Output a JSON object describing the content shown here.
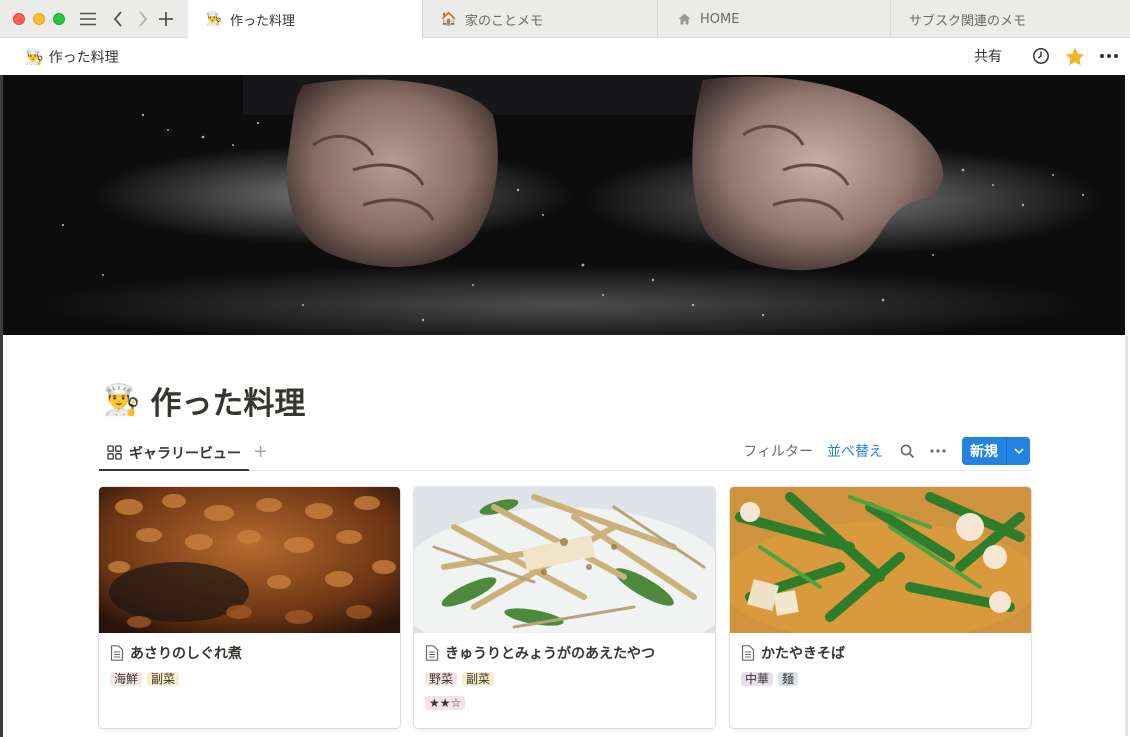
{
  "tabs": [
    {
      "label": "作った料理",
      "icon": "cook-emoji",
      "emoji": "👨‍🍳"
    },
    {
      "label": "家のことメモ",
      "icon": "house-emoji",
      "emoji": "🏠"
    },
    {
      "label": "HOME",
      "icon": "home-icon",
      "emoji": "⌂"
    },
    {
      "label": "サブスク関連のメモ",
      "icon": "",
      "emoji": ""
    }
  ],
  "breadcrumb": {
    "emoji": "👨‍🍳",
    "label": "作った料理"
  },
  "topbar": {
    "share_label": "共有"
  },
  "page": {
    "emoji": "👨‍🍳",
    "title": "作った料理"
  },
  "view": {
    "tab_label": "ギャラリービュー",
    "add_symbol": "+",
    "filter_label": "フィルター",
    "sort_label": "並べ替え",
    "new_label": "新規"
  },
  "cards": [
    {
      "title": "あさりのしぐれ煮",
      "tags": [
        {
          "label": "海鮮",
          "color": "#fbe4e4"
        },
        {
          "label": "副菜",
          "color": "#fdecc8"
        }
      ],
      "rating": ""
    },
    {
      "title": "きゅうりとみょうがのあえたやつ",
      "tags": [
        {
          "label": "野菜",
          "color": "#fbe4e4"
        },
        {
          "label": "副菜",
          "color": "#fdecc8"
        }
      ],
      "rating": "★★☆"
    },
    {
      "title": "かたやきそば",
      "tags": [
        {
          "label": "中華",
          "color": "#e8deee"
        },
        {
          "label": "麺",
          "color": "#d3e5ef"
        }
      ],
      "rating": ""
    }
  ],
  "colors": {
    "accent": "#2383e2",
    "star": "#f0b429",
    "rating_tag": "#f5e0e9"
  }
}
